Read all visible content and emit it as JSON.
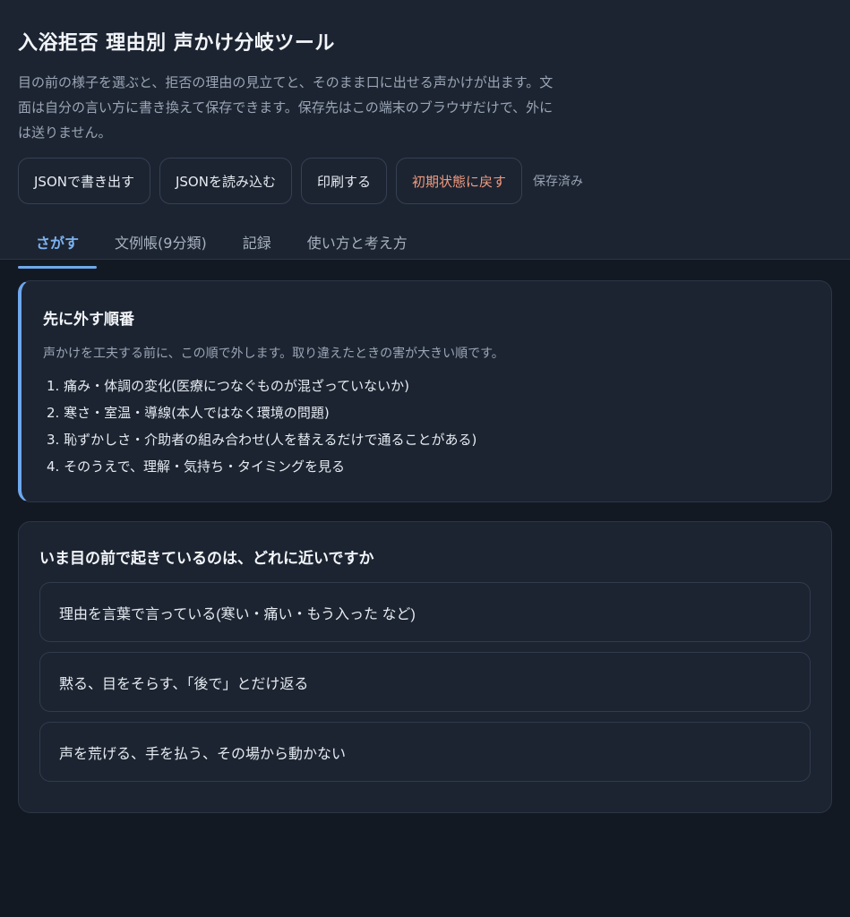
{
  "header": {
    "title": "入浴拒否 理由別 声かけ分岐ツール",
    "intro": "目の前の様子を選ぶと、拒否の理由の見立てと、そのまま口に出せる声かけが出ます。文面は自分の言い方に書き換えて保存できます。保存先はこの端末のブラウザだけで、外には送りません。"
  },
  "actions": {
    "export_label": "JSONで書き出す",
    "import_label": "JSONを読み込む",
    "print_label": "印刷する",
    "reset_label": "初期状態に戻す",
    "save_status": "保存済み"
  },
  "tabs": [
    {
      "label": "さがす",
      "active": true
    },
    {
      "label": "文例帳(9分類)",
      "active": false
    },
    {
      "label": "記録",
      "active": false
    },
    {
      "label": "使い方と考え方",
      "active": false
    }
  ],
  "priority": {
    "title": "先に外す順番",
    "description": "声かけを工夫する前に、この順で外します。取り違えたときの害が大きい順です。",
    "items": [
      "1. 痛み・体調の変化(医療につなぐものが混ざっていないか)",
      "2. 寒さ・室温・導線(本人ではなく環境の問題)",
      "3. 恥ずかしさ・介助者の組み合わせ(人を替えるだけで通ることがある)",
      "4. そのうえで、理解・気持ち・タイミングを見る"
    ]
  },
  "question": {
    "title": "いま目の前で起きているのは、どれに近いですか",
    "choices": [
      "理由を言葉で言っている(寒い・痛い・もう入った など)",
      "黙る、目をそらす、「後で」とだけ返る",
      "声を荒げる、手を払う、その場から動かない"
    ]
  },
  "colors": {
    "accent": "#6ea8ee",
    "danger_text": "#f29a7e",
    "surface": "#1c2431",
    "background": "#131923"
  }
}
